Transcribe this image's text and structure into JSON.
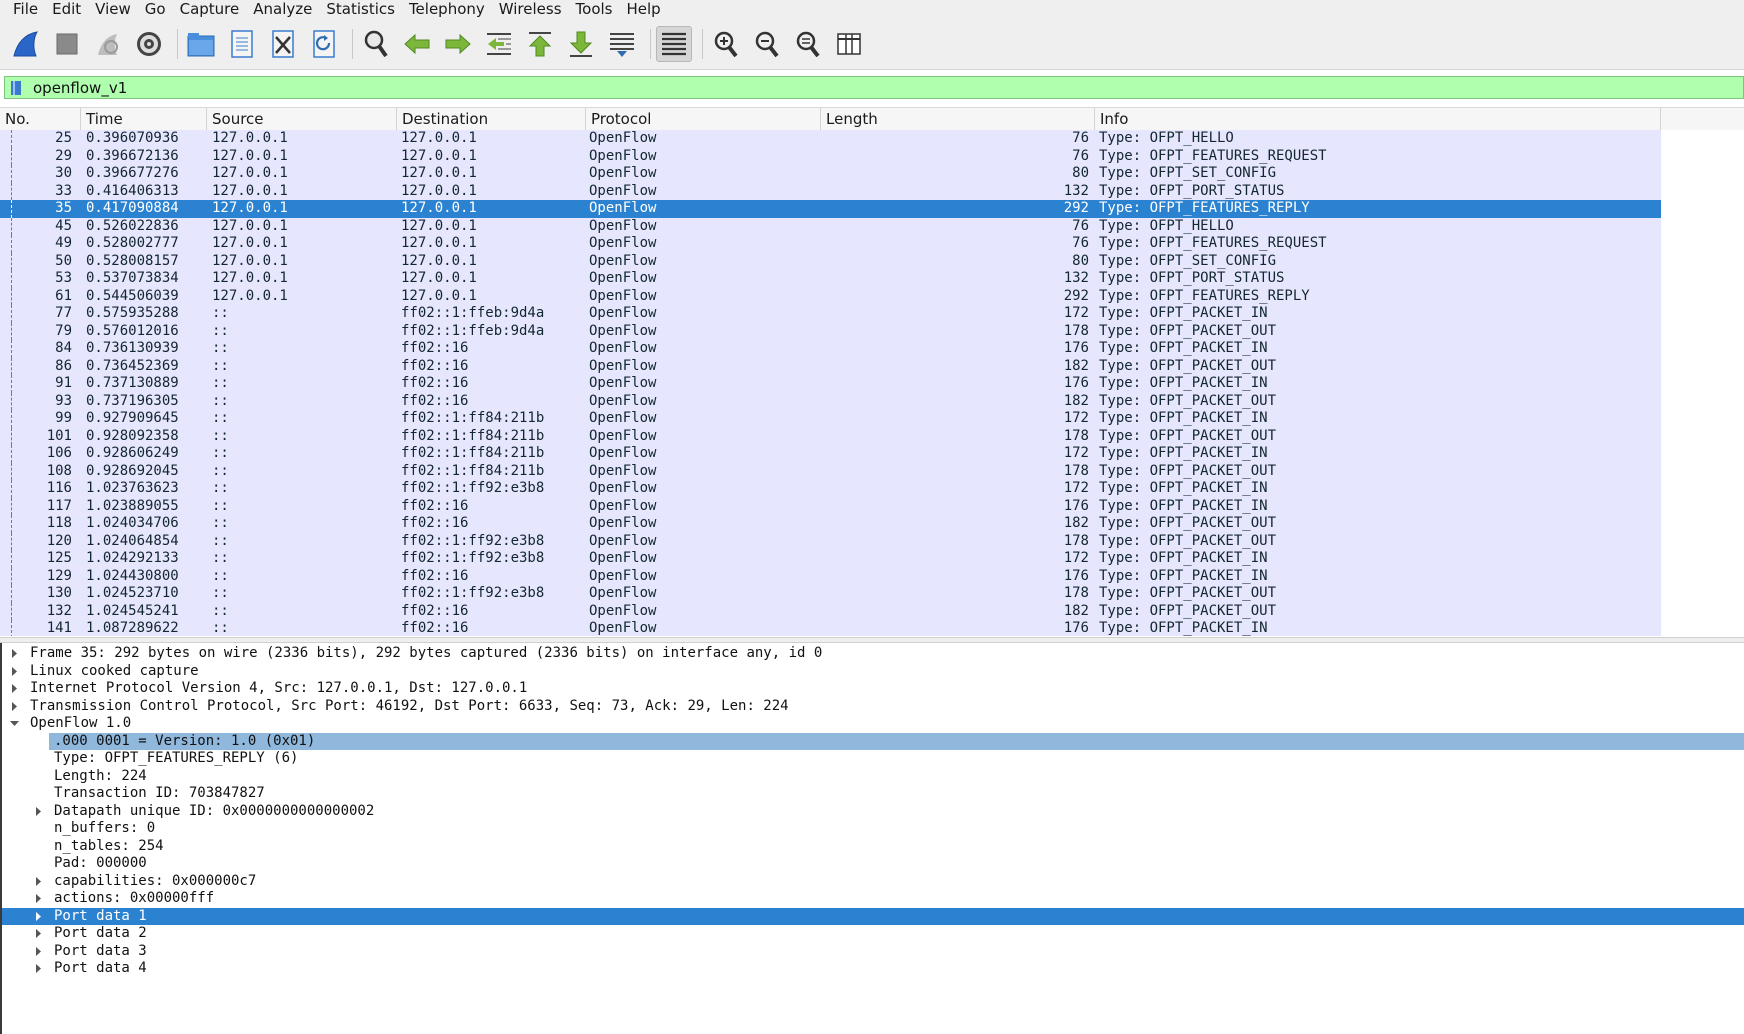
{
  "menu": [
    "File",
    "Edit",
    "View",
    "Go",
    "Capture",
    "Analyze",
    "Statistics",
    "Telephony",
    "Wireless",
    "Tools",
    "Help"
  ],
  "toolbar": {
    "icons": [
      "start-capture-icon",
      "stop-capture-icon",
      "restart-capture-icon",
      "capture-options-icon",
      "open-file-icon",
      "save-file-icon",
      "close-file-icon",
      "reload-file-icon",
      "find-packet-icon",
      "go-back-icon",
      "go-forward-icon",
      "go-to-packet-icon",
      "first-packet-icon",
      "last-packet-icon",
      "auto-scroll-icon",
      "colorize-icon",
      "zoom-in-icon",
      "zoom-out-icon",
      "normal-size-icon",
      "resize-columns-icon"
    ]
  },
  "filter": {
    "value": "openflow_v1",
    "background": "#afffaf"
  },
  "columns": [
    "No.",
    "Time",
    "Source",
    "Destination",
    "Protocol",
    "Length",
    "Info"
  ],
  "packets": [
    {
      "no": "25",
      "time": "0.396070936",
      "src": "127.0.0.1",
      "dst": "127.0.0.1",
      "proto": "OpenFlow",
      "len": "76",
      "info": "Type: OFPT_HELLO"
    },
    {
      "no": "29",
      "time": "0.396672136",
      "src": "127.0.0.1",
      "dst": "127.0.0.1",
      "proto": "OpenFlow",
      "len": "76",
      "info": "Type: OFPT_FEATURES_REQUEST"
    },
    {
      "no": "30",
      "time": "0.396677276",
      "src": "127.0.0.1",
      "dst": "127.0.0.1",
      "proto": "OpenFlow",
      "len": "80",
      "info": "Type: OFPT_SET_CONFIG"
    },
    {
      "no": "33",
      "time": "0.416406313",
      "src": "127.0.0.1",
      "dst": "127.0.0.1",
      "proto": "OpenFlow",
      "len": "132",
      "info": "Type: OFPT_PORT_STATUS"
    },
    {
      "no": "35",
      "time": "0.417090884",
      "src": "127.0.0.1",
      "dst": "127.0.0.1",
      "proto": "OpenFlow",
      "len": "292",
      "info": "Type: OFPT_FEATURES_REPLY",
      "selected": true
    },
    {
      "no": "45",
      "time": "0.526022836",
      "src": "127.0.0.1",
      "dst": "127.0.0.1",
      "proto": "OpenFlow",
      "len": "76",
      "info": "Type: OFPT_HELLO"
    },
    {
      "no": "49",
      "time": "0.528002777",
      "src": "127.0.0.1",
      "dst": "127.0.0.1",
      "proto": "OpenFlow",
      "len": "76",
      "info": "Type: OFPT_FEATURES_REQUEST"
    },
    {
      "no": "50",
      "time": "0.528008157",
      "src": "127.0.0.1",
      "dst": "127.0.0.1",
      "proto": "OpenFlow",
      "len": "80",
      "info": "Type: OFPT_SET_CONFIG"
    },
    {
      "no": "53",
      "time": "0.537073834",
      "src": "127.0.0.1",
      "dst": "127.0.0.1",
      "proto": "OpenFlow",
      "len": "132",
      "info": "Type: OFPT_PORT_STATUS"
    },
    {
      "no": "61",
      "time": "0.544506039",
      "src": "127.0.0.1",
      "dst": "127.0.0.1",
      "proto": "OpenFlow",
      "len": "292",
      "info": "Type: OFPT_FEATURES_REPLY"
    },
    {
      "no": "77",
      "time": "0.575935288",
      "src": "::",
      "dst": "ff02::1:ffeb:9d4a",
      "proto": "OpenFlow",
      "len": "172",
      "info": "Type: OFPT_PACKET_IN"
    },
    {
      "no": "79",
      "time": "0.576012016",
      "src": "::",
      "dst": "ff02::1:ffeb:9d4a",
      "proto": "OpenFlow",
      "len": "178",
      "info": "Type: OFPT_PACKET_OUT"
    },
    {
      "no": "84",
      "time": "0.736130939",
      "src": "::",
      "dst": "ff02::16",
      "proto": "OpenFlow",
      "len": "176",
      "info": "Type: OFPT_PACKET_IN"
    },
    {
      "no": "86",
      "time": "0.736452369",
      "src": "::",
      "dst": "ff02::16",
      "proto": "OpenFlow",
      "len": "182",
      "info": "Type: OFPT_PACKET_OUT"
    },
    {
      "no": "91",
      "time": "0.737130889",
      "src": "::",
      "dst": "ff02::16",
      "proto": "OpenFlow",
      "len": "176",
      "info": "Type: OFPT_PACKET_IN"
    },
    {
      "no": "93",
      "time": "0.737196305",
      "src": "::",
      "dst": "ff02::16",
      "proto": "OpenFlow",
      "len": "182",
      "info": "Type: OFPT_PACKET_OUT"
    },
    {
      "no": "99",
      "time": "0.927909645",
      "src": "::",
      "dst": "ff02::1:ff84:211b",
      "proto": "OpenFlow",
      "len": "172",
      "info": "Type: OFPT_PACKET_IN"
    },
    {
      "no": "101",
      "time": "0.928092358",
      "src": "::",
      "dst": "ff02::1:ff84:211b",
      "proto": "OpenFlow",
      "len": "178",
      "info": "Type: OFPT_PACKET_OUT"
    },
    {
      "no": "106",
      "time": "0.928606249",
      "src": "::",
      "dst": "ff02::1:ff84:211b",
      "proto": "OpenFlow",
      "len": "172",
      "info": "Type: OFPT_PACKET_IN"
    },
    {
      "no": "108",
      "time": "0.928692045",
      "src": "::",
      "dst": "ff02::1:ff84:211b",
      "proto": "OpenFlow",
      "len": "178",
      "info": "Type: OFPT_PACKET_OUT"
    },
    {
      "no": "116",
      "time": "1.023763623",
      "src": "::",
      "dst": "ff02::1:ff92:e3b8",
      "proto": "OpenFlow",
      "len": "172",
      "info": "Type: OFPT_PACKET_IN"
    },
    {
      "no": "117",
      "time": "1.023889055",
      "src": "::",
      "dst": "ff02::16",
      "proto": "OpenFlow",
      "len": "176",
      "info": "Type: OFPT_PACKET_IN"
    },
    {
      "no": "118",
      "time": "1.024034706",
      "src": "::",
      "dst": "ff02::16",
      "proto": "OpenFlow",
      "len": "182",
      "info": "Type: OFPT_PACKET_OUT"
    },
    {
      "no": "120",
      "time": "1.024064854",
      "src": "::",
      "dst": "ff02::1:ff92:e3b8",
      "proto": "OpenFlow",
      "len": "178",
      "info": "Type: OFPT_PACKET_OUT"
    },
    {
      "no": "125",
      "time": "1.024292133",
      "src": "::",
      "dst": "ff02::1:ff92:e3b8",
      "proto": "OpenFlow",
      "len": "172",
      "info": "Type: OFPT_PACKET_IN"
    },
    {
      "no": "129",
      "time": "1.024430800",
      "src": "::",
      "dst": "ff02::16",
      "proto": "OpenFlow",
      "len": "176",
      "info": "Type: OFPT_PACKET_IN"
    },
    {
      "no": "130",
      "time": "1.024523710",
      "src": "::",
      "dst": "ff02::1:ff92:e3b8",
      "proto": "OpenFlow",
      "len": "178",
      "info": "Type: OFPT_PACKET_OUT"
    },
    {
      "no": "132",
      "time": "1.024545241",
      "src": "::",
      "dst": "ff02::16",
      "proto": "OpenFlow",
      "len": "182",
      "info": "Type: OFPT_PACKET_OUT"
    },
    {
      "no": "141",
      "time": "1.087289622",
      "src": "::",
      "dst": "ff02::16",
      "proto": "OpenFlow",
      "len": "176",
      "info": "Type: OFPT_PACKET_IN"
    }
  ],
  "details": [
    {
      "text": "Frame 35: 292 bytes on wire (2336 bits), 292 bytes captured (2336 bits) on interface any, id 0",
      "level": 0,
      "arrow": "right"
    },
    {
      "text": "Linux cooked capture",
      "level": 0,
      "arrow": "right"
    },
    {
      "text": "Internet Protocol Version 4, Src: 127.0.0.1, Dst: 127.0.0.1",
      "level": 0,
      "arrow": "right"
    },
    {
      "text": "Transmission Control Protocol, Src Port: 46192, Dst Port: 6633, Seq: 73, Ack: 29, Len: 224",
      "level": 0,
      "arrow": "right"
    },
    {
      "text": "OpenFlow 1.0",
      "level": 0,
      "arrow": "down"
    },
    {
      "text": ".000 0001 = Version: 1.0 (0x01)",
      "level": 1,
      "arrow": "none",
      "state": "highlight"
    },
    {
      "text": "Type: OFPT_FEATURES_REPLY (6)",
      "level": 1,
      "arrow": "none"
    },
    {
      "text": "Length: 224",
      "level": 1,
      "arrow": "none"
    },
    {
      "text": "Transaction ID: 703847827",
      "level": 1,
      "arrow": "none"
    },
    {
      "text": "Datapath unique ID: 0x0000000000000002",
      "level": 1,
      "arrow": "right"
    },
    {
      "text": "n_buffers: 0",
      "level": 1,
      "arrow": "none"
    },
    {
      "text": "n_tables: 254",
      "level": 1,
      "arrow": "none"
    },
    {
      "text": "Pad: 000000",
      "level": 1,
      "arrow": "none"
    },
    {
      "text": "capabilities: 0x000000c7",
      "level": 1,
      "arrow": "right"
    },
    {
      "text": "actions: 0x00000fff",
      "level": 1,
      "arrow": "right"
    },
    {
      "text": "Port data 1",
      "level": 1,
      "arrow": "right",
      "state": "selected"
    },
    {
      "text": "Port data 2",
      "level": 1,
      "arrow": "right"
    },
    {
      "text": "Port data 3",
      "level": 1,
      "arrow": "right"
    },
    {
      "text": "Port data 4",
      "level": 1,
      "arrow": "right"
    }
  ],
  "colors": {
    "row_bg": "#e7e6ff",
    "row_fg": "#12272e",
    "selected_bg": "#2b82d0",
    "field_highlight_bg": "#8fb8dc"
  }
}
